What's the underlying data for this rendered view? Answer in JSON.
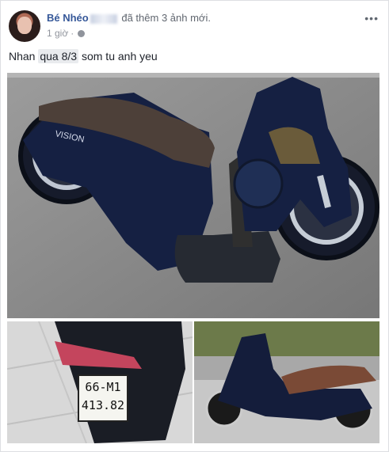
{
  "post": {
    "author": "Bé Nhéo",
    "action": "đã thêm 3 ảnh mới.",
    "time": "1 giờ",
    "text_before": "Nhan",
    "tagged_text": "qua 8/3",
    "text_after": "som tu anh yeu"
  },
  "photos": [
    {
      "name": "motorbike-main-photo",
      "plate_top": "",
      "plate_bottom": ""
    },
    {
      "name": "license-plate-photo",
      "plate_top": "66-M1",
      "plate_bottom": "413.82"
    },
    {
      "name": "motorbike-side-photo"
    }
  ],
  "brand_text": "VISION",
  "icons": {
    "more": "more-options-icon",
    "privacy": "globe-icon"
  }
}
